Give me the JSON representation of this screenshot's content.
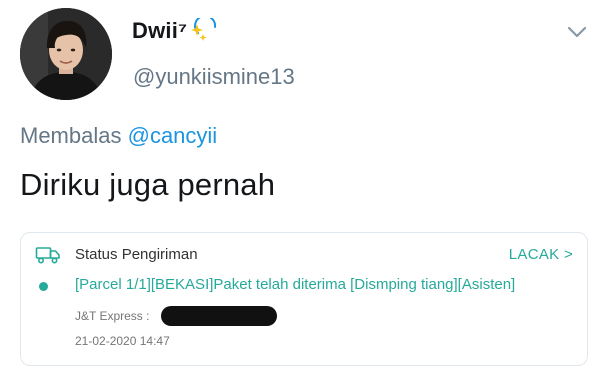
{
  "tweet": {
    "display_name": "Dwii⁷",
    "handle": "@yunkiismine13",
    "reply_prefix": "Membalas",
    "reply_mention": "@cancyii",
    "text": "Diriku juga pernah"
  },
  "icons": {
    "avatar": "profile-photo",
    "name_emoji": "sparkle-icon",
    "menu": "chevron-down-icon",
    "card": "truck-icon"
  },
  "shipment_card": {
    "title": "Status Pengiriman",
    "track_label": "LACAK >",
    "status_detail": "[Parcel 1/1][BEKASI]Paket telah diterima [Dismping tiang][Asisten]",
    "courier_label": "J&T Express :",
    "timestamp": "21-02-2020 14:47"
  },
  "colors": {
    "accent_teal": "#26aa99",
    "mention_blue": "#1b95e0",
    "secondary_text": "#657786"
  }
}
